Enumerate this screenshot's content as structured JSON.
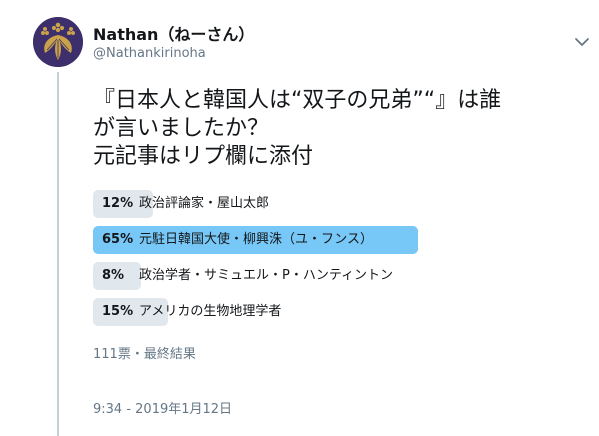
{
  "author": {
    "display_name": "Nathan（ねーさん）",
    "screen_name": "@Nathankirinoha",
    "avatar_icon": "paulownia-crest-icon",
    "avatar_bg": "#3d2f6b",
    "avatar_fg": "#c9a24b"
  },
  "tweet": {
    "text_lines": [
      "『日本人と韓国人は“双子の兄弟”“』は誰",
      "が言いましたか？",
      "元記事はリプ欄に添付"
    ]
  },
  "poll": {
    "options": [
      {
        "percent": "12%",
        "fraction": 0.12,
        "label": "政治評論家・屋山太郎",
        "winner": false
      },
      {
        "percent": "65%",
        "fraction": 0.65,
        "label": "元駐日韓国大使・柳興洙（ユ・フンス）",
        "winner": true
      },
      {
        "percent": "8%",
        "fraction": 0.08,
        "label": "政治学者・サミュエル・P・ハンティントン",
        "winner": false
      },
      {
        "percent": "15%",
        "fraction": 0.15,
        "label": "アメリカの生物地理学者",
        "winner": false
      }
    ],
    "footer": "111票・最終結果",
    "bar_color": "#e1e8ed",
    "winner_color": "#77c7f7"
  },
  "timestamp": "9:34 - 2019年1月12日",
  "icons": {
    "more": "chevron-down-icon"
  }
}
